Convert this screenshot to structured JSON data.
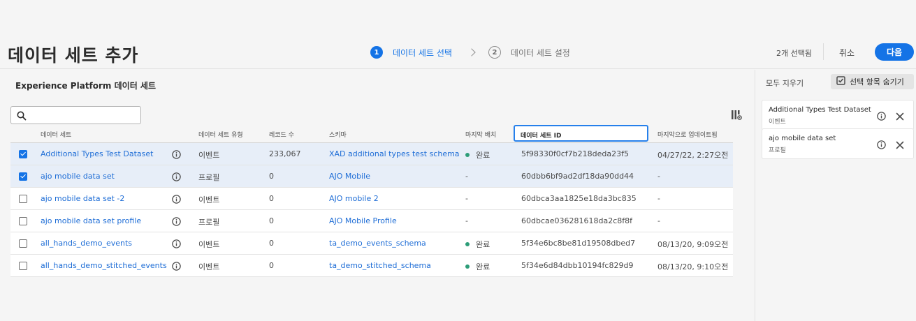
{
  "header": {
    "title": "데이터 세트 추가",
    "steps": [
      {
        "number": "1",
        "label": "데이터 세트 선택",
        "active": true
      },
      {
        "number": "2",
        "label": "데이터 세트 설정",
        "active": false
      }
    ],
    "selected_count": "2개 선택됨",
    "cancel_label": "취소",
    "next_label": "다음"
  },
  "main": {
    "section_title": "Experience Platform 데이터 세트",
    "search": {
      "value": "",
      "placeholder": ""
    },
    "columns": [
      "데이터 세트",
      "데이터 세트 유형",
      "레코드 수",
      "스키마",
      "마지막 배치",
      "데이터 세트 ID",
      "마지막으로 업데이트됨"
    ],
    "rows": [
      {
        "checked": true,
        "name": "Additional Types Test Dataset",
        "type": "이벤트",
        "records": "233,067",
        "schema": "XAD additional types test schema",
        "batch": "완료",
        "batch_ok": true,
        "id": "5f98330f0cf7b218deda23f5",
        "updated": "04/27/22, 2:27오전"
      },
      {
        "checked": true,
        "name": "ajo mobile data set",
        "type": "프로필",
        "records": "0",
        "schema": "AJO Mobile",
        "batch": "-",
        "batch_ok": false,
        "id": "60dbb6bf9ad2df18da90dd44",
        "updated": "-"
      },
      {
        "checked": false,
        "name": "ajo mobile data set -2",
        "type": "이벤트",
        "records": "0",
        "schema": "AJO mobile 2",
        "batch": "-",
        "batch_ok": false,
        "id": "60dbca3aa1825e18da3bc835",
        "updated": "-"
      },
      {
        "checked": false,
        "name": "ajo mobile data set profile",
        "type": "프로필",
        "records": "0",
        "schema": "AJO Mobile Profile",
        "batch": "-",
        "batch_ok": false,
        "id": "60dbcae036281618da2c8f8f",
        "updated": "-"
      },
      {
        "checked": false,
        "name": "all_hands_demo_events",
        "type": "이벤트",
        "records": "0",
        "schema": "ta_demo_events_schema",
        "batch": "완료",
        "batch_ok": true,
        "id": "5f34e6bc8be81d19508dbed7",
        "updated": "08/13/20, 9:09오전"
      },
      {
        "checked": false,
        "name": "all_hands_demo_stitched_events",
        "type": "이벤트",
        "records": "0",
        "schema": "ta_demo_stitched_schema",
        "batch": "완료",
        "batch_ok": true,
        "id": "5f34e6d84dbb10194fc829d9",
        "updated": "08/13/20, 9:10오전"
      }
    ]
  },
  "panel": {
    "clear_all_label": "모두 지우기",
    "hide_selected_label": "선택 항목 숨기기",
    "selected": [
      {
        "name": "Additional Types Test Dataset",
        "type": "이벤트"
      },
      {
        "name": "ajo mobile data set",
        "type": "프로필"
      }
    ]
  },
  "colors": {
    "accent": "#1473e6",
    "link": "#1e6dd6",
    "success": "#2d9d78",
    "selected_row": "#e7eef8"
  }
}
